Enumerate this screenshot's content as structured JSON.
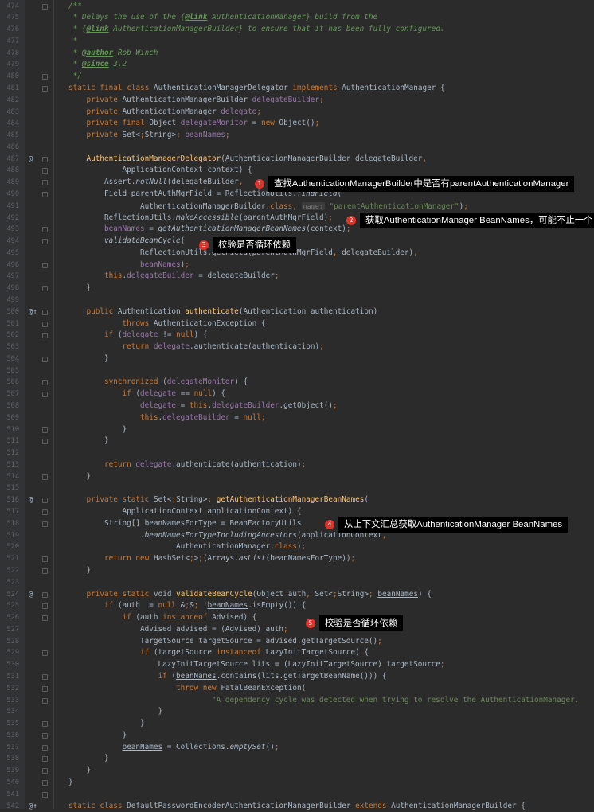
{
  "gutter_markers": {
    "487": "@",
    "500": "@↑",
    "516": "@",
    "524": "@",
    "542": "@↑"
  },
  "fold_lines": [
    474,
    480,
    481,
    487,
    488,
    489,
    490,
    493,
    494,
    496,
    498,
    500,
    501,
    502,
    504,
    506,
    507,
    510,
    511,
    514,
    516,
    517,
    518,
    521,
    522,
    524,
    525,
    526,
    529,
    531,
    532,
    533,
    535,
    536,
    537,
    538,
    539,
    540,
    541
  ],
  "lines": [
    {
      "n": "474",
      "t": "/**",
      "c": "cm"
    },
    {
      "n": "475",
      "t": " * Delays the use of the {@link AuthenticationManager} build from the",
      "c": "cm"
    },
    {
      "n": "476",
      "t": " * {@link AuthenticationManagerBuilder} to ensure that it has been fully configured.",
      "c": "cm"
    },
    {
      "n": "477",
      "t": " *",
      "c": "cm"
    },
    {
      "n": "478",
      "t": " * @author Rob Winch",
      "c": "cm"
    },
    {
      "n": "479",
      "t": " * @since 3.2",
      "c": "cm"
    },
    {
      "n": "480",
      "t": " */",
      "c": "cm"
    },
    {
      "n": "481",
      "t": "static final class AuthenticationManagerDelegator implements AuthenticationManager {"
    },
    {
      "n": "482",
      "t": "    private AuthenticationManagerBuilder delegateBuilder;"
    },
    {
      "n": "483",
      "t": "    private AuthenticationManager delegate;"
    },
    {
      "n": "484",
      "t": "    private final Object delegateMonitor = new Object();"
    },
    {
      "n": "485",
      "t": "    private Set<String> beanNames;"
    },
    {
      "n": "486",
      "t": ""
    },
    {
      "n": "487",
      "t": "    AuthenticationManagerDelegator(AuthenticationManagerBuilder delegateBuilder,"
    },
    {
      "n": "488",
      "t": "            ApplicationContext context) {"
    },
    {
      "n": "489",
      "t": "        Assert.notNull(delegateBuilder, "
    },
    {
      "n": "490",
      "t": "        Field parentAuthMgrField = ReflectionUtils.findField("
    },
    {
      "n": "491",
      "t": "                AuthenticationManagerBuilder.class, name: \"parentAuthenticationManager\");"
    },
    {
      "n": "492",
      "t": "        ReflectionUtils.makeAccessible(parentAuthMgrField);"
    },
    {
      "n": "493",
      "t": "        beanNames = getAuthenticationManagerBeanNames(context);"
    },
    {
      "n": "494",
      "t": "        validateBeanCycle("
    },
    {
      "n": "495",
      "t": "                ReflectionUtils.getField(parentAuthMgrField, delegateBuilder),"
    },
    {
      "n": "496",
      "t": "                beanNames);"
    },
    {
      "n": "497",
      "t": "        this.delegateBuilder = delegateBuilder;"
    },
    {
      "n": "498",
      "t": "    }"
    },
    {
      "n": "499",
      "t": ""
    },
    {
      "n": "500",
      "t": "    public Authentication authenticate(Authentication authentication)"
    },
    {
      "n": "501",
      "t": "            throws AuthenticationException {"
    },
    {
      "n": "502",
      "t": "        if (delegate != null) {"
    },
    {
      "n": "503",
      "t": "            return delegate.authenticate(authentication);"
    },
    {
      "n": "504",
      "t": "        }"
    },
    {
      "n": "505",
      "t": ""
    },
    {
      "n": "506",
      "t": "        synchronized (delegateMonitor) {"
    },
    {
      "n": "507",
      "t": "            if (delegate == null) {"
    },
    {
      "n": "508",
      "t": "                delegate = this.delegateBuilder.getObject();"
    },
    {
      "n": "509",
      "t": "                this.delegateBuilder = null;"
    },
    {
      "n": "510",
      "t": "            }"
    },
    {
      "n": "511",
      "t": "        }"
    },
    {
      "n": "512",
      "t": ""
    },
    {
      "n": "513",
      "t": "        return delegate.authenticate(authentication);"
    },
    {
      "n": "514",
      "t": "    }"
    },
    {
      "n": "515",
      "t": ""
    },
    {
      "n": "516",
      "t": "    private static Set<String> getAuthenticationManagerBeanNames("
    },
    {
      "n": "517",
      "t": "            ApplicationContext applicationContext) {"
    },
    {
      "n": "518",
      "t": "        String[] beanNamesForType = BeanFactoryUtils"
    },
    {
      "n": "519",
      "t": "                .beanNamesForTypeIncludingAncestors(applicationContext,"
    },
    {
      "n": "520",
      "t": "                        AuthenticationManager.class);"
    },
    {
      "n": "521",
      "t": "        return new HashSet<>(Arrays.asList(beanNamesForType));"
    },
    {
      "n": "522",
      "t": "    }"
    },
    {
      "n": "523",
      "t": ""
    },
    {
      "n": "524",
      "t": "    private static void validateBeanCycle(Object auth, Set<String> beanNames) {"
    },
    {
      "n": "525",
      "t": "        if (auth != null && !beanNames.isEmpty()) {"
    },
    {
      "n": "526",
      "t": "            if (auth instanceof Advised) {"
    },
    {
      "n": "527",
      "t": "                Advised advised = (Advised) auth;"
    },
    {
      "n": "528",
      "t": "                TargetSource targetSource = advised.getTargetSource();"
    },
    {
      "n": "529",
      "t": "                if (targetSource instanceof LazyInitTargetSource) {"
    },
    {
      "n": "530",
      "t": "                    LazyInitTargetSource lits = (LazyInitTargetSource) targetSource;"
    },
    {
      "n": "531",
      "t": "                    if (beanNames.contains(lits.getTargetBeanName())) {"
    },
    {
      "n": "532",
      "t": "                        throw new FatalBeanException("
    },
    {
      "n": "533",
      "t": "                                \"A dependency cycle was detected when trying to resolve the AuthenticationManager."
    },
    {
      "n": "534",
      "t": "                    }"
    },
    {
      "n": "535",
      "t": "                }"
    },
    {
      "n": "536",
      "t": "            }"
    },
    {
      "n": "537",
      "t": "            beanNames = Collections.emptySet();"
    },
    {
      "n": "538",
      "t": "        }"
    },
    {
      "n": "539",
      "t": "    }"
    },
    {
      "n": "540",
      "t": "}"
    },
    {
      "n": "541",
      "t": ""
    },
    {
      "n": "542",
      "t": "static class DefaultPasswordEncoderAuthenticationManagerBuilder extends AuthenticationManagerBuilder {"
    }
  ],
  "annotations": [
    {
      "num": "1",
      "text": "查找AuthenticationManagerBuilder中是否有parentAuthenticationManager"
    },
    {
      "num": "2",
      "text": "获取AuthenticationManager BeanNames，可能不止一个"
    },
    {
      "num": "3",
      "text": "校验是否循环依赖"
    },
    {
      "num": "4",
      "text": "从上下文汇总获取AuthenticationManager BeanNames"
    },
    {
      "num": "5",
      "text": "校验是否循环依赖"
    }
  ],
  "colors": {
    "background": "#2b2b2b",
    "gutter": "#313335",
    "keyword": "#cc7832",
    "method": "#ffc66d",
    "field": "#9876aa",
    "comment": "#629755",
    "string": "#6a8759",
    "badge": "#e0342b"
  }
}
